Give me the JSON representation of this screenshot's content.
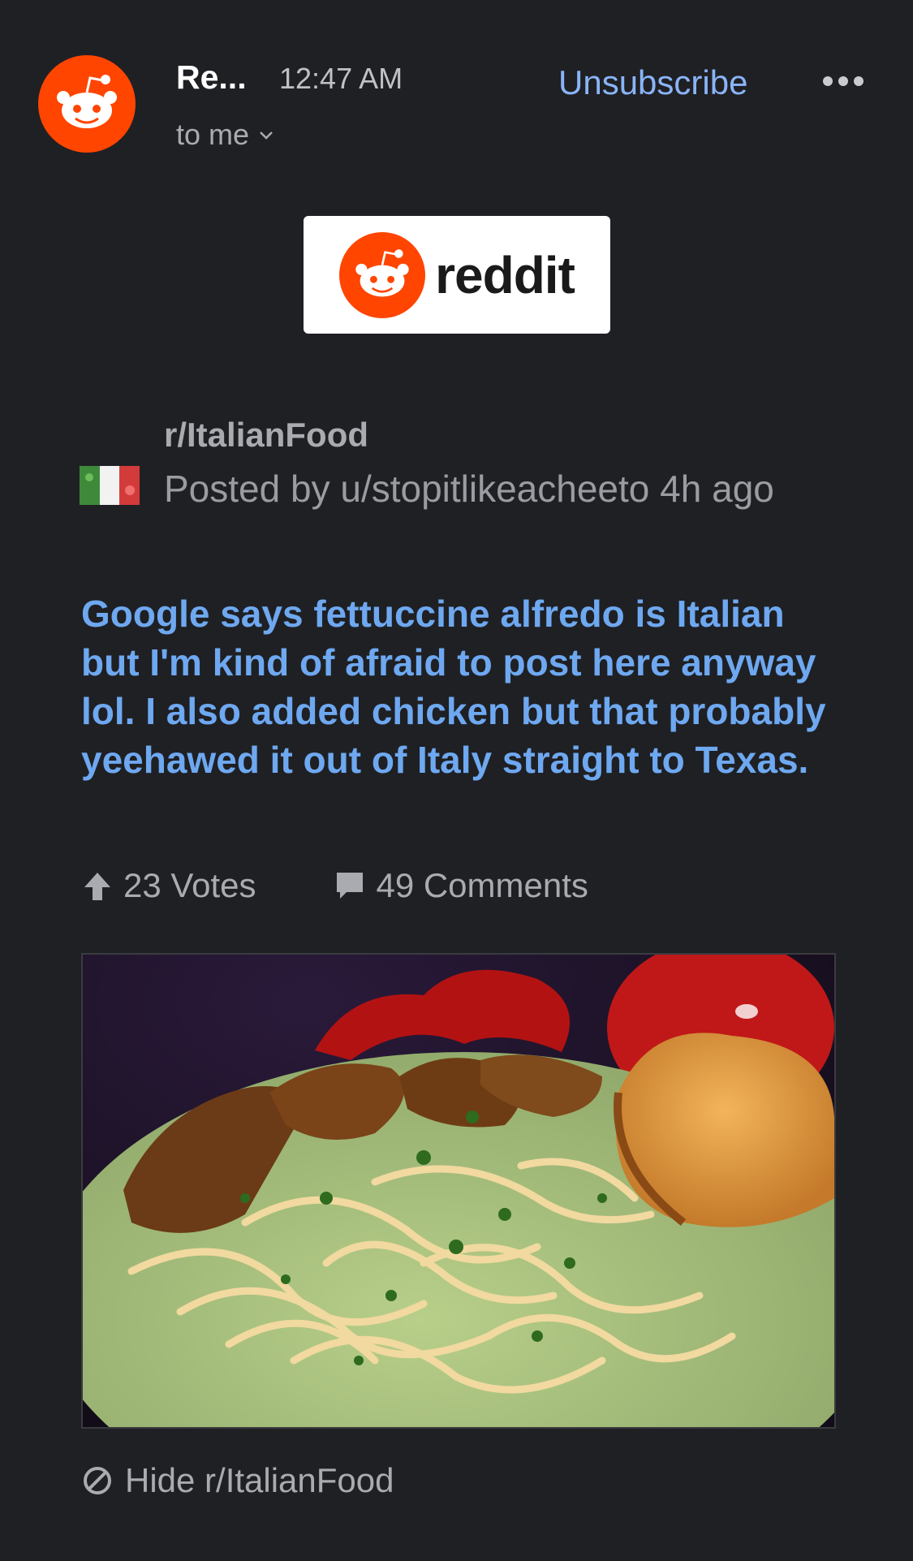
{
  "header": {
    "sender": "Re...",
    "time": "12:47 AM",
    "recipient": "to me",
    "unsubscribe_label": "Unsubscribe"
  },
  "logo": {
    "wordmark": "reddit"
  },
  "post": {
    "subreddit": "r/ItalianFood",
    "posted_by": "Posted by u/stopitlikeacheeto 4h ago",
    "title": "Google says fettuccine alfredo is Italian but I'm kind of afraid to post here anyway lol. I also added chicken but that probably yeehawed it out of Italy straight to Texas.",
    "votes": "23 Votes",
    "comments": "49 Comments"
  },
  "footer": {
    "hide_label": "Hide r/ItalianFood"
  },
  "icons": {
    "avatar": "reddit-snoo-icon",
    "more": "more-horizontal-icon",
    "chevron": "chevron-down-icon",
    "upvote": "upvote-arrow-icon",
    "comment": "comment-bubble-icon",
    "hide": "block-icon"
  },
  "colors": {
    "background": "#1f2024",
    "brand": "#ff4500",
    "link": "#8ab4f8",
    "title": "#6ea8f0",
    "muted": "#a9abb0"
  }
}
